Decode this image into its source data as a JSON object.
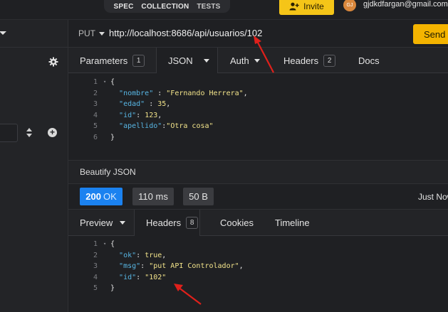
{
  "topbar": {
    "tabs": [
      "SPEC",
      "COLLECTION",
      "TESTS"
    ],
    "invite_label": "Invite",
    "avatar_initials": "GJ",
    "email": "gjdkdfargan@gmail.com"
  },
  "request": {
    "method": "PUT",
    "url": "http://localhost:8686/api/usuarios/102",
    "send_label": "Send",
    "tabs": {
      "parameters": "Parameters",
      "parameters_count": "1",
      "json": "JSON",
      "auth": "Auth",
      "headers": "Headers",
      "headers_count": "2",
      "docs": "Docs"
    },
    "body": {
      "line_numbers": [
        "1",
        "2",
        "3",
        "4",
        "5",
        "6"
      ],
      "open_brace": "{",
      "close_brace": "}",
      "fields": [
        {
          "key": "\"nombre\"",
          "sep": " : ",
          "value": "\"Fernando Herrera\"",
          "tail": ","
        },
        {
          "key": "\"edad\"",
          "sep": " : ",
          "value": "35",
          "tail": ","
        },
        {
          "key": "\"id\"",
          "sep": ": ",
          "value": "123",
          "tail": ","
        },
        {
          "key": "\"apellido\"",
          "sep": ":",
          "value": "\"Otra cosa\"",
          "tail": ""
        }
      ]
    },
    "beautify_label": "Beautify JSON"
  },
  "response": {
    "status_code": "200",
    "status_text": "OK",
    "time": "110 ms",
    "size": "50 B",
    "timestamp": "Just Now",
    "tabs": {
      "preview": "Preview",
      "headers": "Headers",
      "headers_count": "8",
      "cookies": "Cookies",
      "timeline": "Timeline"
    },
    "body": {
      "line_numbers": [
        "1",
        "2",
        "3",
        "4",
        "5"
      ],
      "open_brace": "{",
      "close_brace": "}",
      "fields": [
        {
          "key": "\"ok\"",
          "sep": ": ",
          "value": "true",
          "tail": ","
        },
        {
          "key": "\"msg\"",
          "sep": ": ",
          "value": "\"put API Controlador\"",
          "tail": ","
        },
        {
          "key": "\"id\"",
          "sep": ": ",
          "value": "\"102\"",
          "tail": ""
        }
      ]
    }
  },
  "colors": {
    "accent_send": "#f4b400",
    "accent_invite": "#f5c518",
    "status_ok": "#1b82f0",
    "json_key": "#58b6e4",
    "json_value": "#f2e38a",
    "annotation_arrow": "#e0201b"
  },
  "icons": {
    "gear": "gear-icon",
    "plus": "plus-circle-icon",
    "sort": "sort-icon",
    "invite": "user-plus-icon",
    "caret": "chevron-down-icon"
  }
}
